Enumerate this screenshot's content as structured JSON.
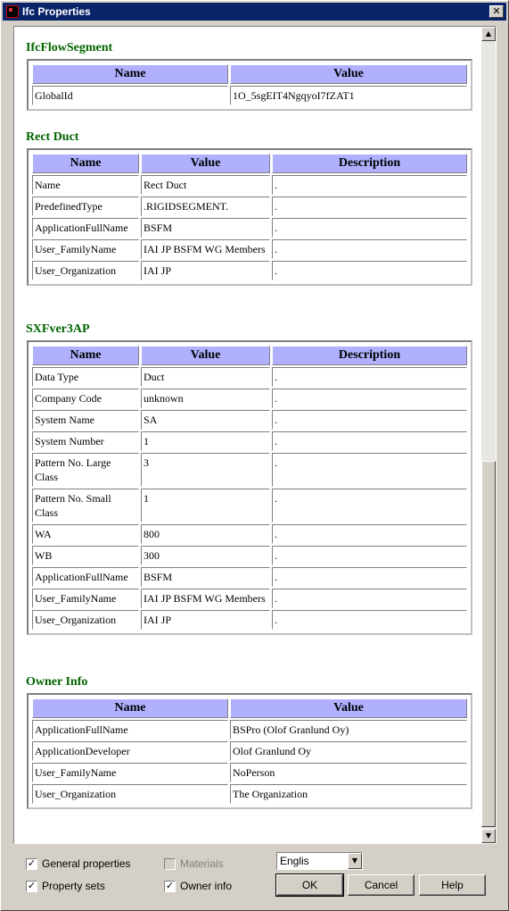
{
  "window": {
    "title": "Ifc Properties",
    "close": "✕"
  },
  "sections": [
    {
      "title": "IfcFlowSegment",
      "columns": [
        "Name",
        "Value"
      ],
      "rows": [
        [
          "GlobalId",
          "1O_5sgEIT4NgqyoI7fZAT1"
        ]
      ]
    },
    {
      "title": "Rect Duct",
      "columns": [
        "Name",
        "Value",
        "Description"
      ],
      "rows": [
        [
          "Name",
          "Rect Duct",
          "."
        ],
        [
          "PredefinedType",
          ".RIGIDSEGMENT.",
          "."
        ],
        [
          "ApplicationFullName",
          "BSFM",
          "."
        ],
        [
          "User_FamilyName",
          "IAI JP BSFM WG Members",
          "."
        ],
        [
          "User_Organization",
          "IAI JP",
          "."
        ]
      ]
    },
    {
      "title": "SXFver3AP",
      "columns": [
        "Name",
        "Value",
        "Description"
      ],
      "rows": [
        [
          "Data Type",
          "Duct",
          "."
        ],
        [
          "Company Code",
          "unknown",
          "."
        ],
        [
          "System Name",
          "SA",
          "."
        ],
        [
          "System Number",
          "1",
          "."
        ],
        [
          "Pattern No. Large Class",
          "3",
          "."
        ],
        [
          "Pattern No. Small Class",
          "1",
          "."
        ],
        [
          "WA",
          "800",
          "."
        ],
        [
          "WB",
          "300",
          "."
        ],
        [
          "ApplicationFullName",
          "BSFM",
          "."
        ],
        [
          "User_FamilyName",
          "IAI JP BSFM WG Members",
          "."
        ],
        [
          "User_Organization",
          "IAI JP",
          "."
        ]
      ]
    },
    {
      "title": "Owner Info",
      "columns": [
        "Name",
        "Value"
      ],
      "rows": [
        [
          "ApplicationFullName",
          "BSPro (Olof Granlund Oy)"
        ],
        [
          "ApplicationDeveloper",
          "Olof Granlund Oy"
        ],
        [
          "User_FamilyName",
          "NoPerson"
        ],
        [
          "User_Organization",
          "The Organization"
        ]
      ]
    }
  ],
  "options": {
    "general_properties": {
      "label": "General properties",
      "checked": true
    },
    "materials": {
      "label": "Materials",
      "checked": false,
      "enabled": false
    },
    "property_sets": {
      "label": "Property sets",
      "checked": true
    },
    "owner_info": {
      "label": "Owner info",
      "checked": true
    }
  },
  "language": {
    "selected": "Englis"
  },
  "buttons": {
    "ok": "OK",
    "cancel": "Cancel",
    "help": "Help"
  },
  "scrollbar": {
    "up": "▲",
    "down": "▼"
  },
  "colors": {
    "title_bar": "#0a246a",
    "section_title": "#006400",
    "header_bg": "#b0b0ff"
  }
}
